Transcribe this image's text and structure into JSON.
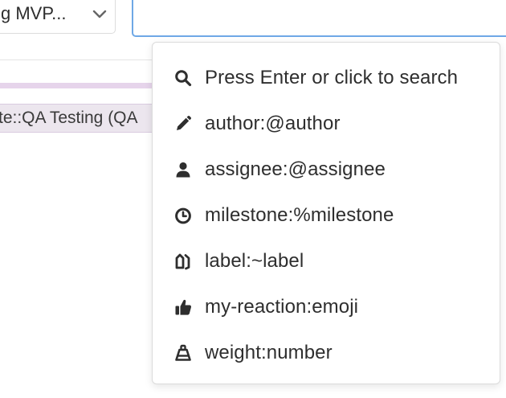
{
  "milestone_filter": {
    "selected": "g MVP..."
  },
  "search": {
    "value": "",
    "placeholder": ""
  },
  "issue": {
    "scoped_label": "te::QA Testing (QA"
  },
  "search_menu": {
    "items": [
      {
        "icon": "search-icon",
        "label": "Press Enter or click to search"
      },
      {
        "icon": "pencil-icon",
        "label": "author:@author"
      },
      {
        "icon": "user-icon",
        "label": "assignee:@assignee"
      },
      {
        "icon": "clock-icon",
        "label": "milestone:%milestone"
      },
      {
        "icon": "labels-icon",
        "label": "label:~label"
      },
      {
        "icon": "thumbs-up-icon",
        "label": "my-reaction:emoji"
      },
      {
        "icon": "weight-icon",
        "label": "weight:number"
      }
    ]
  },
  "colors": {
    "focus_border": "#6fa8e6",
    "label_background": "#ece6ee",
    "label_stripe": "#e6d4eb"
  }
}
